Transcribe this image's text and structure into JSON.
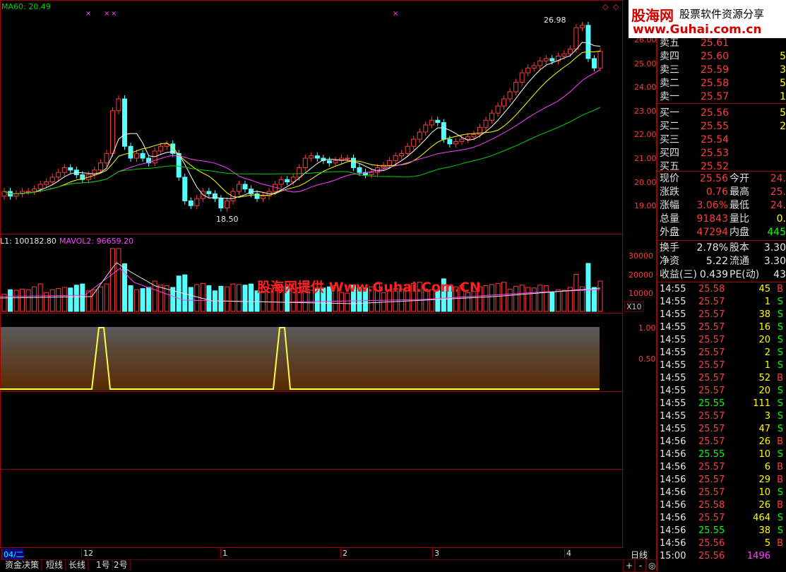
{
  "main_chart": {
    "ma_label": "MA60: 20.49",
    "high_label": "26.98",
    "low_label": "18.50",
    "price_axis": [
      "26.00",
      "25.00",
      "24.00",
      "23.00",
      "22.00",
      "21.00",
      "20.00",
      "19.00"
    ]
  },
  "volume_chart": {
    "label_mavol1": "L1: 100182.80",
    "label_mavol2": "MAVOL2: 96659.20",
    "axis": [
      "30000",
      "20000",
      "10000"
    ],
    "unit": "X10"
  },
  "indicator_chart": {
    "axis": [
      "1.00",
      "0.50"
    ]
  },
  "watermark": "股海网提供 Www.Guhai.Com.CN",
  "logo": {
    "name": "股海网",
    "slogan": "股票软件资源分享",
    "url": "www.Guhai.com.cn"
  },
  "date_axis": {
    "labels": [
      "04/二",
      "12",
      "1",
      "2",
      "3",
      "4"
    ],
    "period": "日线"
  },
  "bottom_tabs": [
    "资金决策",
    "短线",
    "长线",
    "1号",
    "2号"
  ],
  "bottom_buttons": [
    "+",
    "-",
    "◎"
  ],
  "order_book": {
    "sell": [
      {
        "label": "卖五",
        "price": "25.61",
        "vol": ""
      },
      {
        "label": "卖四",
        "price": "25.60",
        "vol": "5"
      },
      {
        "label": "卖三",
        "price": "25.59",
        "vol": "3"
      },
      {
        "label": "卖二",
        "price": "25.58",
        "vol": "5"
      },
      {
        "label": "卖一",
        "price": "25.57",
        "vol": "1"
      }
    ],
    "buy": [
      {
        "label": "买一",
        "price": "25.56",
        "vol": "5"
      },
      {
        "label": "买二",
        "price": "25.55",
        "vol": "2"
      },
      {
        "label": "买三",
        "price": "25.54",
        "vol": ""
      },
      {
        "label": "买四",
        "price": "25.53",
        "vol": ""
      },
      {
        "label": "买五",
        "price": "25.52",
        "vol": ""
      }
    ]
  },
  "quote": {
    "rows": [
      {
        "l1": "现价",
        "v1": "25.56",
        "l2": "今开",
        "v2": "24."
      },
      {
        "l1": "涨跌",
        "v1": "0.76",
        "l2": "最高",
        "v2": "25."
      },
      {
        "l1": "涨幅",
        "v1": "3.06%",
        "l2": "最低",
        "v2": "24."
      },
      {
        "l1": "总量",
        "v1": "91843",
        "l2": "量比",
        "v2": "0."
      },
      {
        "l1": "外盘",
        "v1": "47294",
        "l2": "内盘",
        "v2": "445"
      }
    ],
    "rows2": [
      {
        "l1": "换手",
        "v1": "2.78%",
        "l2": "股本",
        "v2": "3.30"
      },
      {
        "l1": "净资",
        "v1": "5.22",
        "l2": "流通",
        "v2": "3.30"
      },
      {
        "l1": "收益(三)",
        "v1": "0.439",
        "l2": "PE(动)",
        "v2": "43"
      }
    ]
  },
  "ticks": [
    {
      "t": "14:55",
      "p": "25.58",
      "v": "45",
      "s": "B"
    },
    {
      "t": "14:55",
      "p": "25.57",
      "v": "1",
      "s": "S"
    },
    {
      "t": "14:55",
      "p": "25.57",
      "v": "38",
      "s": "S"
    },
    {
      "t": "14:55",
      "p": "25.57",
      "v": "16",
      "s": "S"
    },
    {
      "t": "14:55",
      "p": "25.57",
      "v": "20",
      "s": "S"
    },
    {
      "t": "14:55",
      "p": "25.57",
      "v": "2",
      "s": "S"
    },
    {
      "t": "14:55",
      "p": "25.57",
      "v": "1",
      "s": "S"
    },
    {
      "t": "14:55",
      "p": "25.57",
      "v": "52",
      "s": "B"
    },
    {
      "t": "14:55",
      "p": "25.57",
      "v": "20",
      "s": "S"
    },
    {
      "t": "14:55",
      "p": "25.55",
      "v": "111",
      "s": "S"
    },
    {
      "t": "14:55",
      "p": "25.57",
      "v": "3",
      "s": "S"
    },
    {
      "t": "14:55",
      "p": "25.57",
      "v": "47",
      "s": "S"
    },
    {
      "t": "14:56",
      "p": "25.57",
      "v": "26",
      "s": "B"
    },
    {
      "t": "14:56",
      "p": "25.55",
      "v": "10",
      "s": "S"
    },
    {
      "t": "14:56",
      "p": "25.57",
      "v": "6",
      "s": "B"
    },
    {
      "t": "14:56",
      "p": "25.57",
      "v": "29",
      "s": "B"
    },
    {
      "t": "14:56",
      "p": "25.57",
      "v": "10",
      "s": "S"
    },
    {
      "t": "14:56",
      "p": "25.58",
      "v": "26",
      "s": "B"
    },
    {
      "t": "14:56",
      "p": "25.57",
      "v": "464",
      "s": "S"
    },
    {
      "t": "14:56",
      "p": "25.55",
      "v": "38",
      "s": "S"
    },
    {
      "t": "14:56",
      "p": "25.56",
      "v": "5",
      "s": "B"
    },
    {
      "t": "15:00",
      "p": "25.56",
      "v": "1496",
      "s": ""
    }
  ],
  "colors": {
    "up": "#ff3c3c",
    "down": "#54ffff",
    "ma5": "#ffffff",
    "ma10": "#ffff00",
    "ma20": "#ff40ff",
    "ma60": "#00d000",
    "border": "#a00000"
  }
}
